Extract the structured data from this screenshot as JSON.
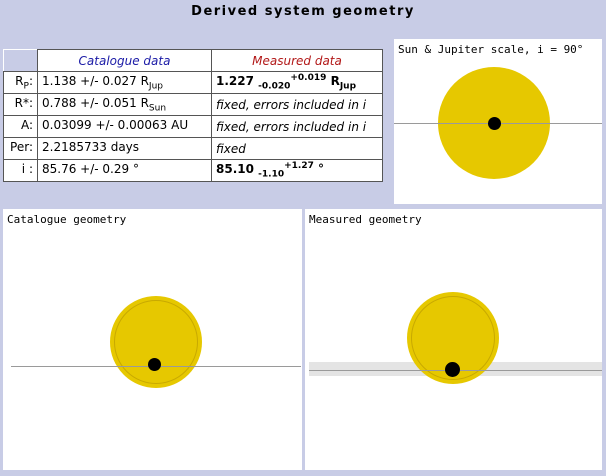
{
  "title": "Derived system geometry",
  "table": {
    "header": {
      "catalogue": "Catalogue data",
      "measured": "Measured data"
    },
    "rows": [
      {
        "label_main": "R",
        "label_sub": "P",
        "label_suffix": ":",
        "cat_main": "1.138 +/- 0.027 R",
        "cat_sub": "Jup",
        "meas_type": "value",
        "meas_value": "1.227",
        "meas_minus": "-0.020",
        "meas_plus": "+0.019",
        "meas_unit": "R",
        "meas_unit_sub": "Jup"
      },
      {
        "label_main": "R*:",
        "label_sub": "",
        "label_suffix": "",
        "cat_main": "0.788 +/- 0.051 R",
        "cat_sub": "Sun",
        "meas_type": "text",
        "meas_text": "fixed, errors included in i"
      },
      {
        "label_main": "A:",
        "label_sub": "",
        "label_suffix": "",
        "cat_main": "0.03099 +/- 0.00063 AU",
        "cat_sub": "",
        "meas_type": "text",
        "meas_text": "fixed, errors included in i"
      },
      {
        "label_main": "Per:",
        "label_sub": "",
        "label_suffix": "",
        "cat_main": "2.2185733 days",
        "cat_sub": "",
        "meas_type": "text",
        "meas_text": "fixed"
      },
      {
        "label_main": "i :",
        "label_sub": "",
        "label_suffix": "",
        "cat_main": "85.76 +/- 0.29 °",
        "cat_sub": "",
        "meas_type": "value",
        "meas_value": "85.10",
        "meas_minus": "-1.10",
        "meas_plus": "+1.27",
        "meas_unit": " °",
        "meas_unit_sub": ""
      }
    ]
  },
  "panels": {
    "scale": {
      "title": "Sun & Jupiter scale, i = 90°"
    },
    "catalogue": {
      "title": "Catalogue geometry"
    },
    "measured": {
      "title": "Measured geometry"
    }
  },
  "colors": {
    "background": "#c8cce6",
    "sun": "#e6c800",
    "planet": "#000000",
    "catalogue_header": "#1a1aa6",
    "measured_header": "#b21818"
  }
}
